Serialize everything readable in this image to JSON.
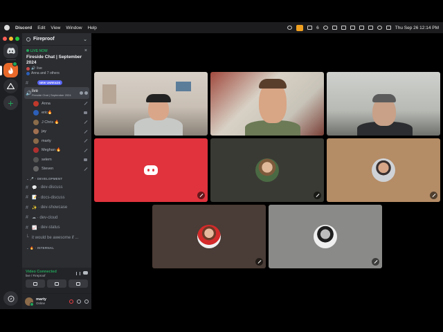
{
  "menubar": {
    "app": "Discord",
    "items": [
      "Edit",
      "View",
      "Window",
      "Help"
    ],
    "indicator_count": "6",
    "datetime": "Thu Sep 26  12:14 PM"
  },
  "server": {
    "name": "Fireproof"
  },
  "event": {
    "live_label": "LIVE NOW",
    "title": "Fireside Chat | September 2024",
    "channel": "live",
    "attendees": "Anna and 7 others"
  },
  "channels": {
    "new_unreads": "NEW UNREADS",
    "active": {
      "name": "live",
      "subtitle": "Fireside Chat | September 2024"
    },
    "voice_users": [
      {
        "name": "Anna",
        "color": "#c0392b",
        "status": "muted"
      },
      {
        "name": "eric🔥",
        "color": "#2c5fb8",
        "status": "camera"
      },
      {
        "name": "J Chris 🔥",
        "color": "#8a6b4a",
        "status": "muted"
      },
      {
        "name": "jay",
        "color": "#a07050",
        "status": "muted"
      },
      {
        "name": "marty",
        "color": "#8b6b4a",
        "status": "muted"
      },
      {
        "name": "Meghan 🔥",
        "color": "#b03030",
        "status": "muted"
      },
      {
        "name": "selem",
        "color": "#555555",
        "status": "camera"
      },
      {
        "name": "Steven",
        "color": "#666666",
        "status": "muted"
      }
    ],
    "categories": [
      {
        "label": "DEVELOPMENT",
        "items": [
          "dev-discuss",
          "docs-discuss",
          "dev-showcase",
          "dev-cloud",
          "dev-status",
          "it would be awesome if ..."
        ]
      },
      {
        "label": "INTERNAL",
        "items": []
      }
    ]
  },
  "voice_status": {
    "title": "Video Connected",
    "subtitle": "live / Fireproof"
  },
  "me": {
    "name": "marty",
    "status": "Online"
  },
  "colors": {
    "discord_red": "#e0333d",
    "online_green": "#23a55a",
    "sidebar_bg": "#2b2d31",
    "rail_bg": "#1e1f22"
  }
}
